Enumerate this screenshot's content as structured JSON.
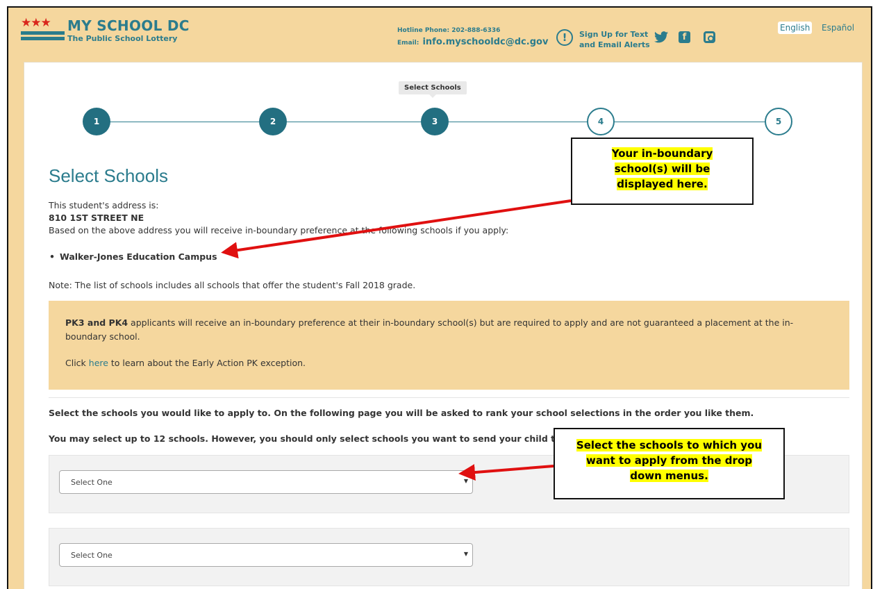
{
  "header": {
    "logo_stars": "★★★",
    "logo_title": "MY SCHOOL DC",
    "logo_subtitle": "The Public School Lottery",
    "hotline": "Hotline Phone: 202-888-6336",
    "email_label": "Email:",
    "email": "info.myschooldc@dc.gov",
    "alert_line1": "Sign Up for Text",
    "alert_line2": "and Email Alerts",
    "lang_english": "English",
    "lang_spanish": "Español"
  },
  "stepper": {
    "tooltip": "Select Schools",
    "steps": [
      "1",
      "2",
      "3",
      "4",
      "5"
    ],
    "current_step": 3
  },
  "main": {
    "title": "Select Schools",
    "address_intro": "This student's address is:",
    "address": "810 1ST STREET NE",
    "boundary_text": "Based on the above address you will receive in-boundary preference at the following schools if you apply:",
    "schools": [
      "Walker-Jones Education Campus"
    ],
    "note": "Note: The list of schools includes all schools that offer the student's Fall 2018 grade.",
    "notice_bold": "PK3 and PK4",
    "notice_text": " applicants will receive an in-boundary preference at their in-boundary school(s) but are required to apply and are not guaranteed a placement at the in-boundary school.",
    "click_prefix": "Click ",
    "click_link": "here",
    "click_suffix": " to learn about the Early Action PK exception.",
    "instruction1": "Select the schools you would like to apply to. On the following page you will be asked to rank your school selections in the order you like them.",
    "instruction2": "You may select up to 12 schools. However, you should only select schools you want to send your child to.",
    "select_placeholder_1": "Select One",
    "select_placeholder_2": "Select One"
  },
  "annotations": {
    "callout1": [
      "Your in-boundary",
      "school(s) will be",
      "displayed here."
    ],
    "callout2": [
      "Select the schools to which you",
      "want to apply from the drop",
      "down menus."
    ]
  },
  "colors": {
    "accent": "#2b7c8d",
    "header_bg": "#f5d79e",
    "annotation_arrow": "#e01010",
    "highlight": "#ffff00"
  }
}
